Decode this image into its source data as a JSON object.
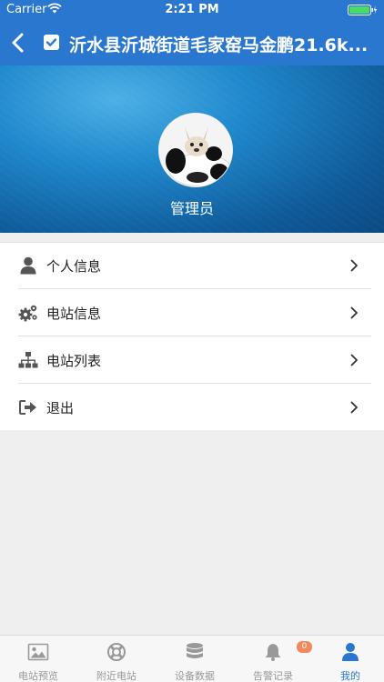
{
  "status_bar": {
    "carrier": "Carrier",
    "time": "2:21 PM"
  },
  "nav": {
    "title": "沂水县沂城街道毛家窑马金鹏21.6k..."
  },
  "profile": {
    "name": "管理员"
  },
  "menu": {
    "items": [
      {
        "label": "个人信息",
        "icon": "user-icon"
      },
      {
        "label": "电站信息",
        "icon": "gears-icon"
      },
      {
        "label": "电站列表",
        "icon": "sitemap-icon"
      },
      {
        "label": "退出",
        "icon": "sign-out-icon"
      }
    ]
  },
  "tabbar": {
    "tabs": [
      {
        "label": "电站预览",
        "icon": "picture-icon"
      },
      {
        "label": "附近电站",
        "icon": "lifebuoy-icon"
      },
      {
        "label": "设备数据",
        "icon": "database-icon"
      },
      {
        "label": "告警记录",
        "icon": "bell-icon",
        "badge": "0"
      },
      {
        "label": "我的",
        "icon": "user-icon",
        "active": true
      }
    ]
  },
  "colors": {
    "primary": "#2a77cf",
    "badge": "#f08a5d",
    "inactive": "#999999"
  }
}
